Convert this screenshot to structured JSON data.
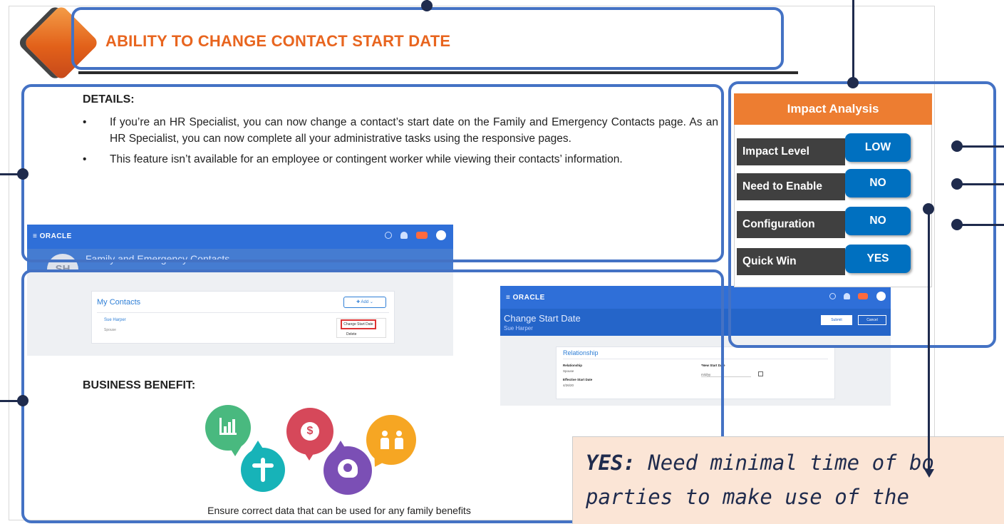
{
  "slide": {
    "title": "ABILITY TO CHANGE CONTACT START DATE"
  },
  "details": {
    "heading": "DETAILS:",
    "bullets": [
      "If you’re an HR Specialist, you can now change a contact’s start date on the Family and Emergency Contacts page. As an HR Specialist, you can now complete all your administrative tasks using the responsive pages.",
      "This feature isn’t available for an employee or contingent worker while viewing their contacts’ information."
    ]
  },
  "screenshot_contacts": {
    "logo": "≡ ORACLE",
    "page_title": "Family and Emergency Contacts",
    "avatar_initials": "SH",
    "section_title": "My Contacts",
    "add_label": "✚ Add ⌄",
    "contact_name": "Sue Harper",
    "contact_relation": "Spouse",
    "menu_change": "Change Start Date",
    "menu_delete": "Delete"
  },
  "screenshot_change": {
    "logo": "≡ ORACLE",
    "page_title": "Change Start Date",
    "person": "Sue Harper",
    "submit_label": "Submit",
    "cancel_label": "Cancel",
    "section_title": "Relationship",
    "relationship_label": "Relationship",
    "relationship_value": "Spouse",
    "new_start_label": "*New Start Date",
    "new_start_placeholder": "m/d/yy",
    "effective_label": "Effective Start Date",
    "effective_value": "4/26/20"
  },
  "benefit": {
    "heading": "BUSINESS BENEFIT:",
    "caption": "Ensure correct data that can be used for any family benefits"
  },
  "impact": {
    "header": "Impact Analysis",
    "rows": [
      {
        "label": "Impact Level",
        "value": "LOW"
      },
      {
        "label": "Need to Enable",
        "value": "NO"
      },
      {
        "label": "Configuration",
        "value": "NO"
      },
      {
        "label": "Quick Win",
        "value": "YES"
      }
    ]
  },
  "tooltip": {
    "keyword": "YES:",
    "line1": " Need minimal time of bo",
    "line2": "parties to make use of the"
  },
  "colors": {
    "accent_orange": "#ed7d31",
    "highlight_blue": "#4472c4",
    "value_blue": "#0070c0",
    "label_dark": "#404040",
    "tooltip_bg": "#fbe5d6"
  }
}
